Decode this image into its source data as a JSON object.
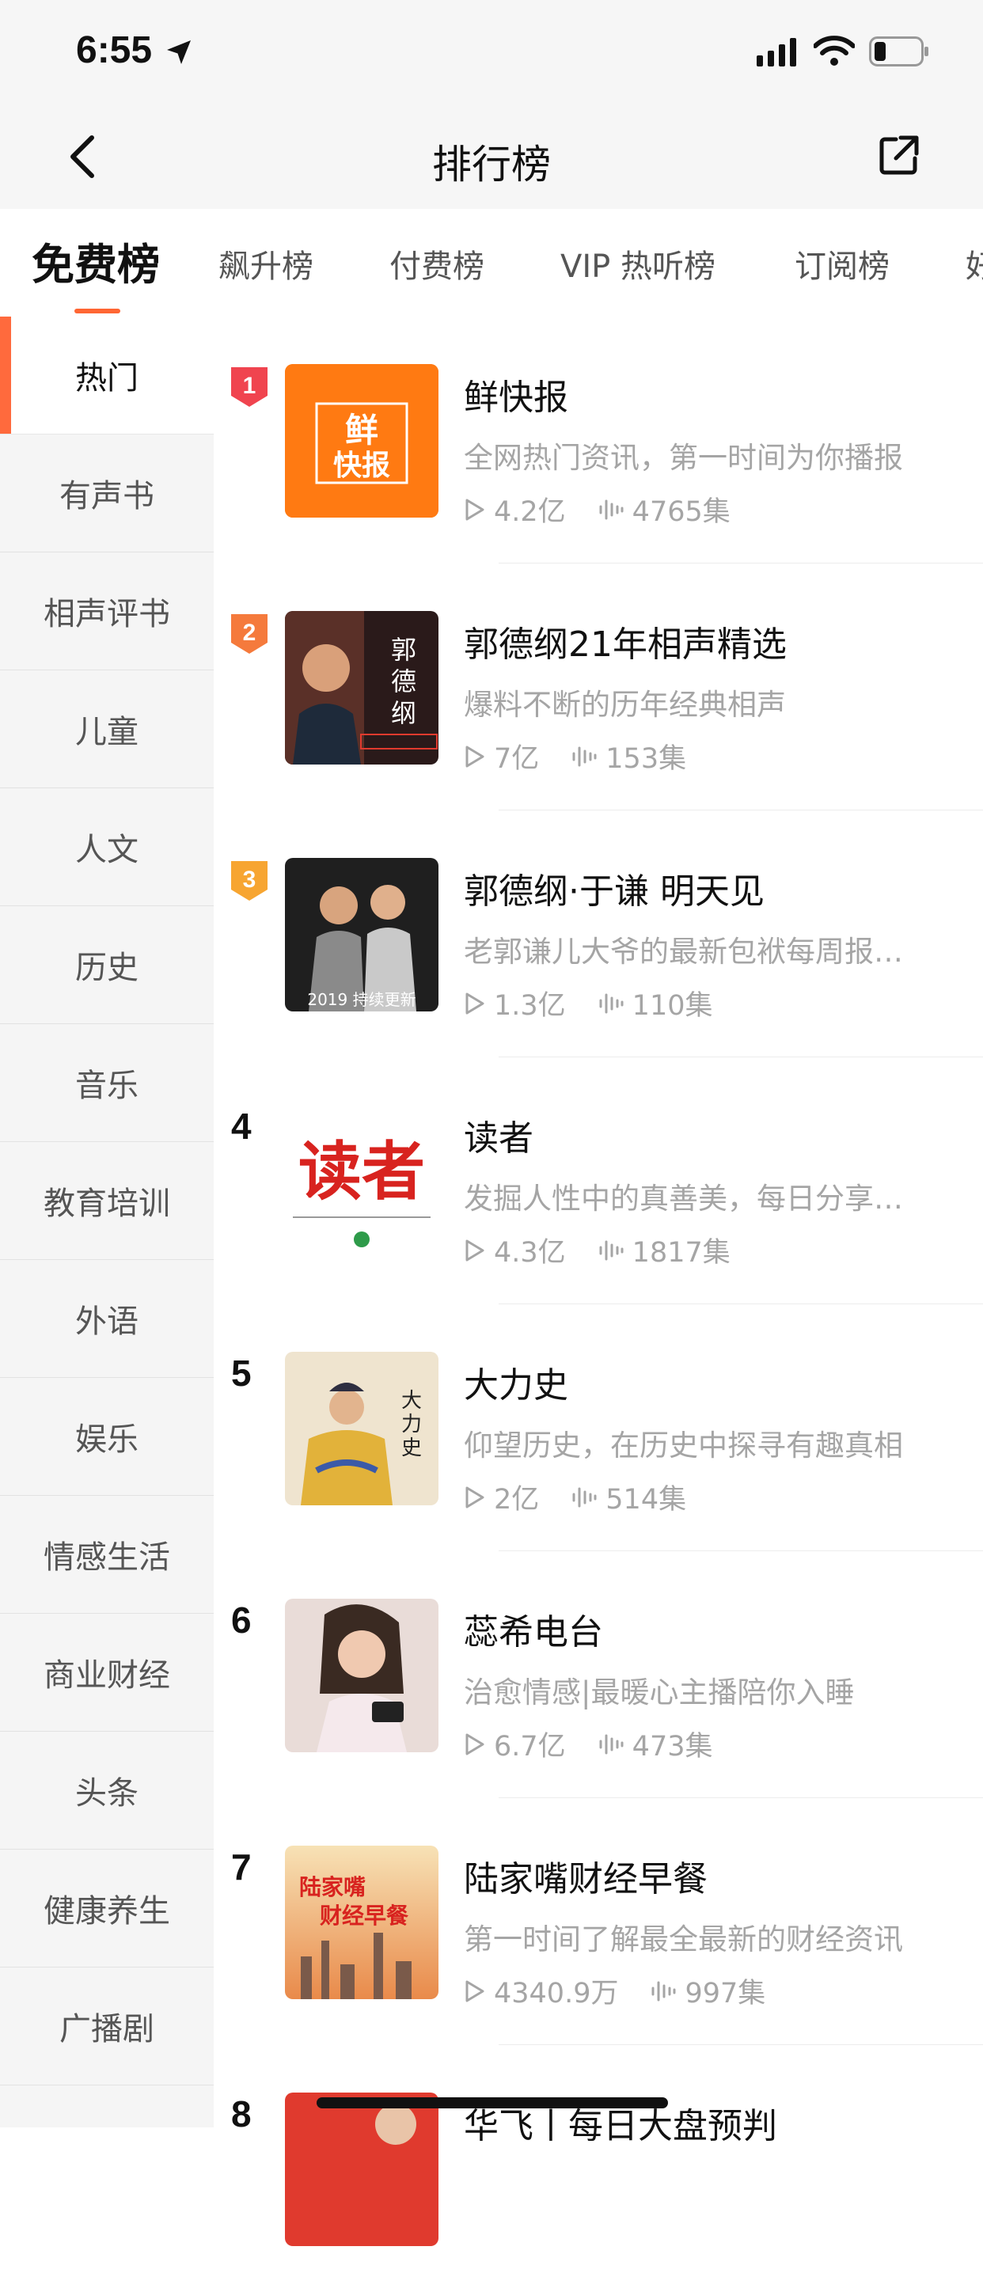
{
  "status_bar": {
    "time": "6:55"
  },
  "nav": {
    "title": "排行榜"
  },
  "tabs": [
    "免费榜",
    "飙升榜",
    "付费榜",
    "VIP 热听榜",
    "订阅榜",
    "好"
  ],
  "sidebar": {
    "items": [
      "热门",
      "有声书",
      "相声评书",
      "儿童",
      "人文",
      "历史",
      "音乐",
      "教育培训",
      "外语",
      "娱乐",
      "情感生活",
      "商业财经",
      "头条",
      "健康养生",
      "广播剧"
    ]
  },
  "list": [
    {
      "rank": "1",
      "title": "鲜快报",
      "desc": "全网热门资讯，第一时间为你播报",
      "plays": "4.2亿",
      "episodes": "4765集",
      "cover_text": "鲜快报"
    },
    {
      "rank": "2",
      "title": "郭德纲21年相声精选",
      "desc": "爆料不断的历年经典相声",
      "plays": "7亿",
      "episodes": "153集",
      "cover_text": "郭德纲"
    },
    {
      "rank": "3",
      "title": "郭德纲·于谦 明天见",
      "desc": "老郭谦儿大爷的最新包袱每周报…",
      "plays": "1.3亿",
      "episodes": "110集",
      "cover_text": "2019持续更新"
    },
    {
      "rank": "4",
      "title": "读者",
      "desc": "发掘人性中的真善美，每日分享…",
      "plays": "4.3亿",
      "episodes": "1817集",
      "cover_text": "读者"
    },
    {
      "rank": "5",
      "title": "大力史",
      "desc": "仰望历史，在历史中探寻有趣真相",
      "plays": "2亿",
      "episodes": "514集",
      "cover_text": "大力史"
    },
    {
      "rank": "6",
      "title": "蕊希电台",
      "desc": "治愈情感|最暖心主播陪你入睡",
      "plays": "6.7亿",
      "episodes": "473集",
      "cover_text": ""
    },
    {
      "rank": "7",
      "title": "陆家嘴财经早餐",
      "desc": "第一时间了解最全最新的财经资讯",
      "plays": "4340.9万",
      "episodes": "997集",
      "cover_text": "陆家嘴财经早餐"
    },
    {
      "rank": "8",
      "title": "华飞丨每日大盘预判",
      "desc": "",
      "plays": "",
      "episodes": "",
      "cover_text": ""
    }
  ],
  "colors": {
    "accent": "#ff6633",
    "rank1": "#f0444f",
    "rank2": "#f57a3c",
    "rank3": "#f7a531"
  }
}
